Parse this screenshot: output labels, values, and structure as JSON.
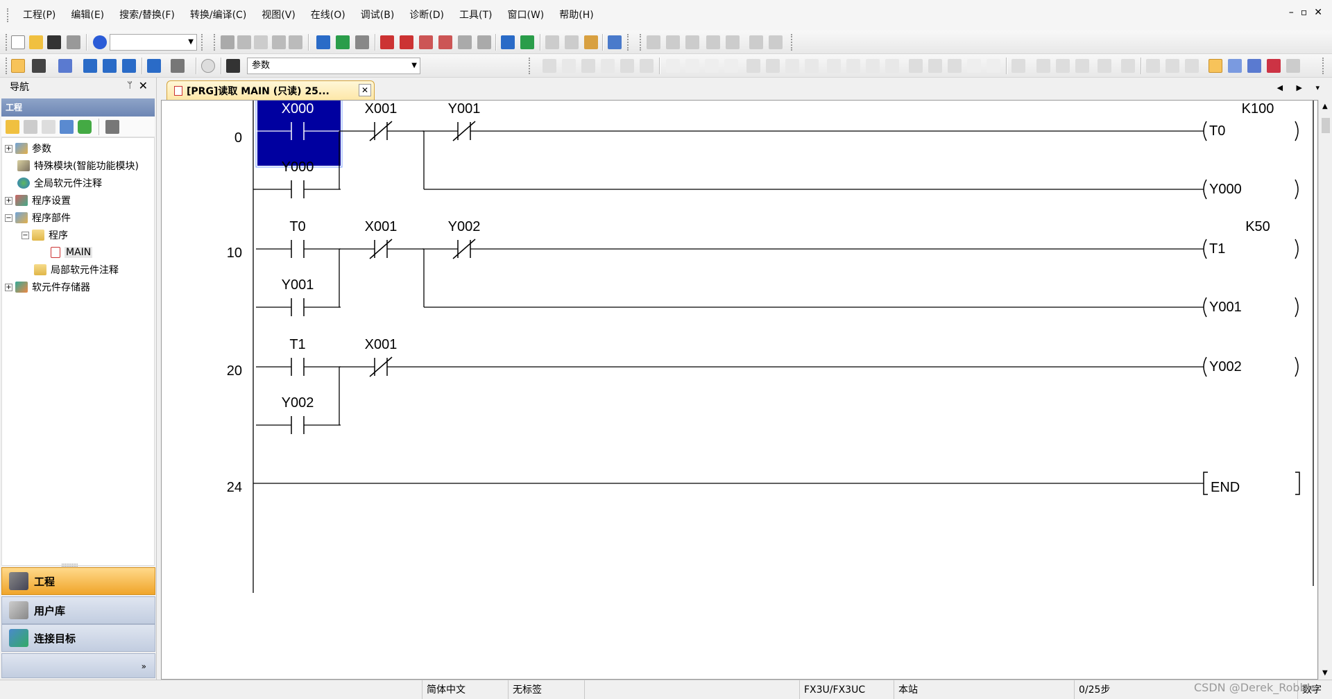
{
  "menu": [
    "工程(P)",
    "编辑(E)",
    "搜索/替换(F)",
    "转换/编译(C)",
    "视图(V)",
    "在线(O)",
    "调试(B)",
    "诊断(D)",
    "工具(T)",
    "窗口(W)",
    "帮助(H)"
  ],
  "window_controls": [
    "–",
    "▫",
    "✕"
  ],
  "toolbar": {
    "combo1_value": "",
    "combo2_value": "参数"
  },
  "nav": {
    "title": "导航",
    "pin": "ᛘ",
    "close": "✕",
    "section": "工程",
    "tree": [
      {
        "label": "参数"
      },
      {
        "label": "特殊模块(智能功能模块)"
      },
      {
        "label": "全局软元件注释"
      },
      {
        "label": "程序设置"
      },
      {
        "label": "程序部件"
      },
      {
        "label": "程序"
      },
      {
        "label": "MAIN"
      },
      {
        "label": "局部软元件注释"
      },
      {
        "label": "软元件存储器"
      }
    ],
    "buttons": {
      "project": "工程",
      "userlib": "用户库",
      "target": "连接目标"
    },
    "more": "»"
  },
  "tab": {
    "label": "[PRG]读取 MAIN (只读) 25...",
    "close": "✕",
    "nav": "◀ ▶ ▾"
  },
  "ladder": {
    "rungs": [
      {
        "step": "0"
      },
      {
        "step": "10"
      },
      {
        "step": "20"
      },
      {
        "step": "24"
      }
    ],
    "contacts": [
      {
        "device": "X000",
        "type": "NO",
        "selected": true
      },
      {
        "device": "X001",
        "type": "NC"
      },
      {
        "device": "Y001",
        "type": "NC"
      },
      {
        "device": "Y000",
        "type": "NO"
      },
      {
        "device": "T0",
        "type": "NO"
      },
      {
        "device": "X001",
        "type": "NC"
      },
      {
        "device": "Y002",
        "type": "NC"
      },
      {
        "device": "Y001",
        "type": "NO"
      },
      {
        "device": "T1",
        "type": "NO"
      },
      {
        "device": "X001",
        "type": "NC"
      },
      {
        "device": "Y002",
        "type": "NO"
      }
    ],
    "coils": [
      {
        "device": "T0",
        "setting": "K100"
      },
      {
        "device": "Y000",
        "setting": ""
      },
      {
        "device": "T1",
        "setting": "K50"
      },
      {
        "device": "Y001",
        "setting": ""
      },
      {
        "device": "Y002",
        "setting": ""
      }
    ],
    "end_label": "END",
    "selection_color": "#0000a0"
  },
  "status": {
    "language": "简体中文",
    "label": "无标签",
    "plc": "FX3U/FX3UC",
    "station": "本站",
    "steps": "0/25步",
    "mode": "数字"
  },
  "watermark": "CSDN @Derek_Robbie"
}
